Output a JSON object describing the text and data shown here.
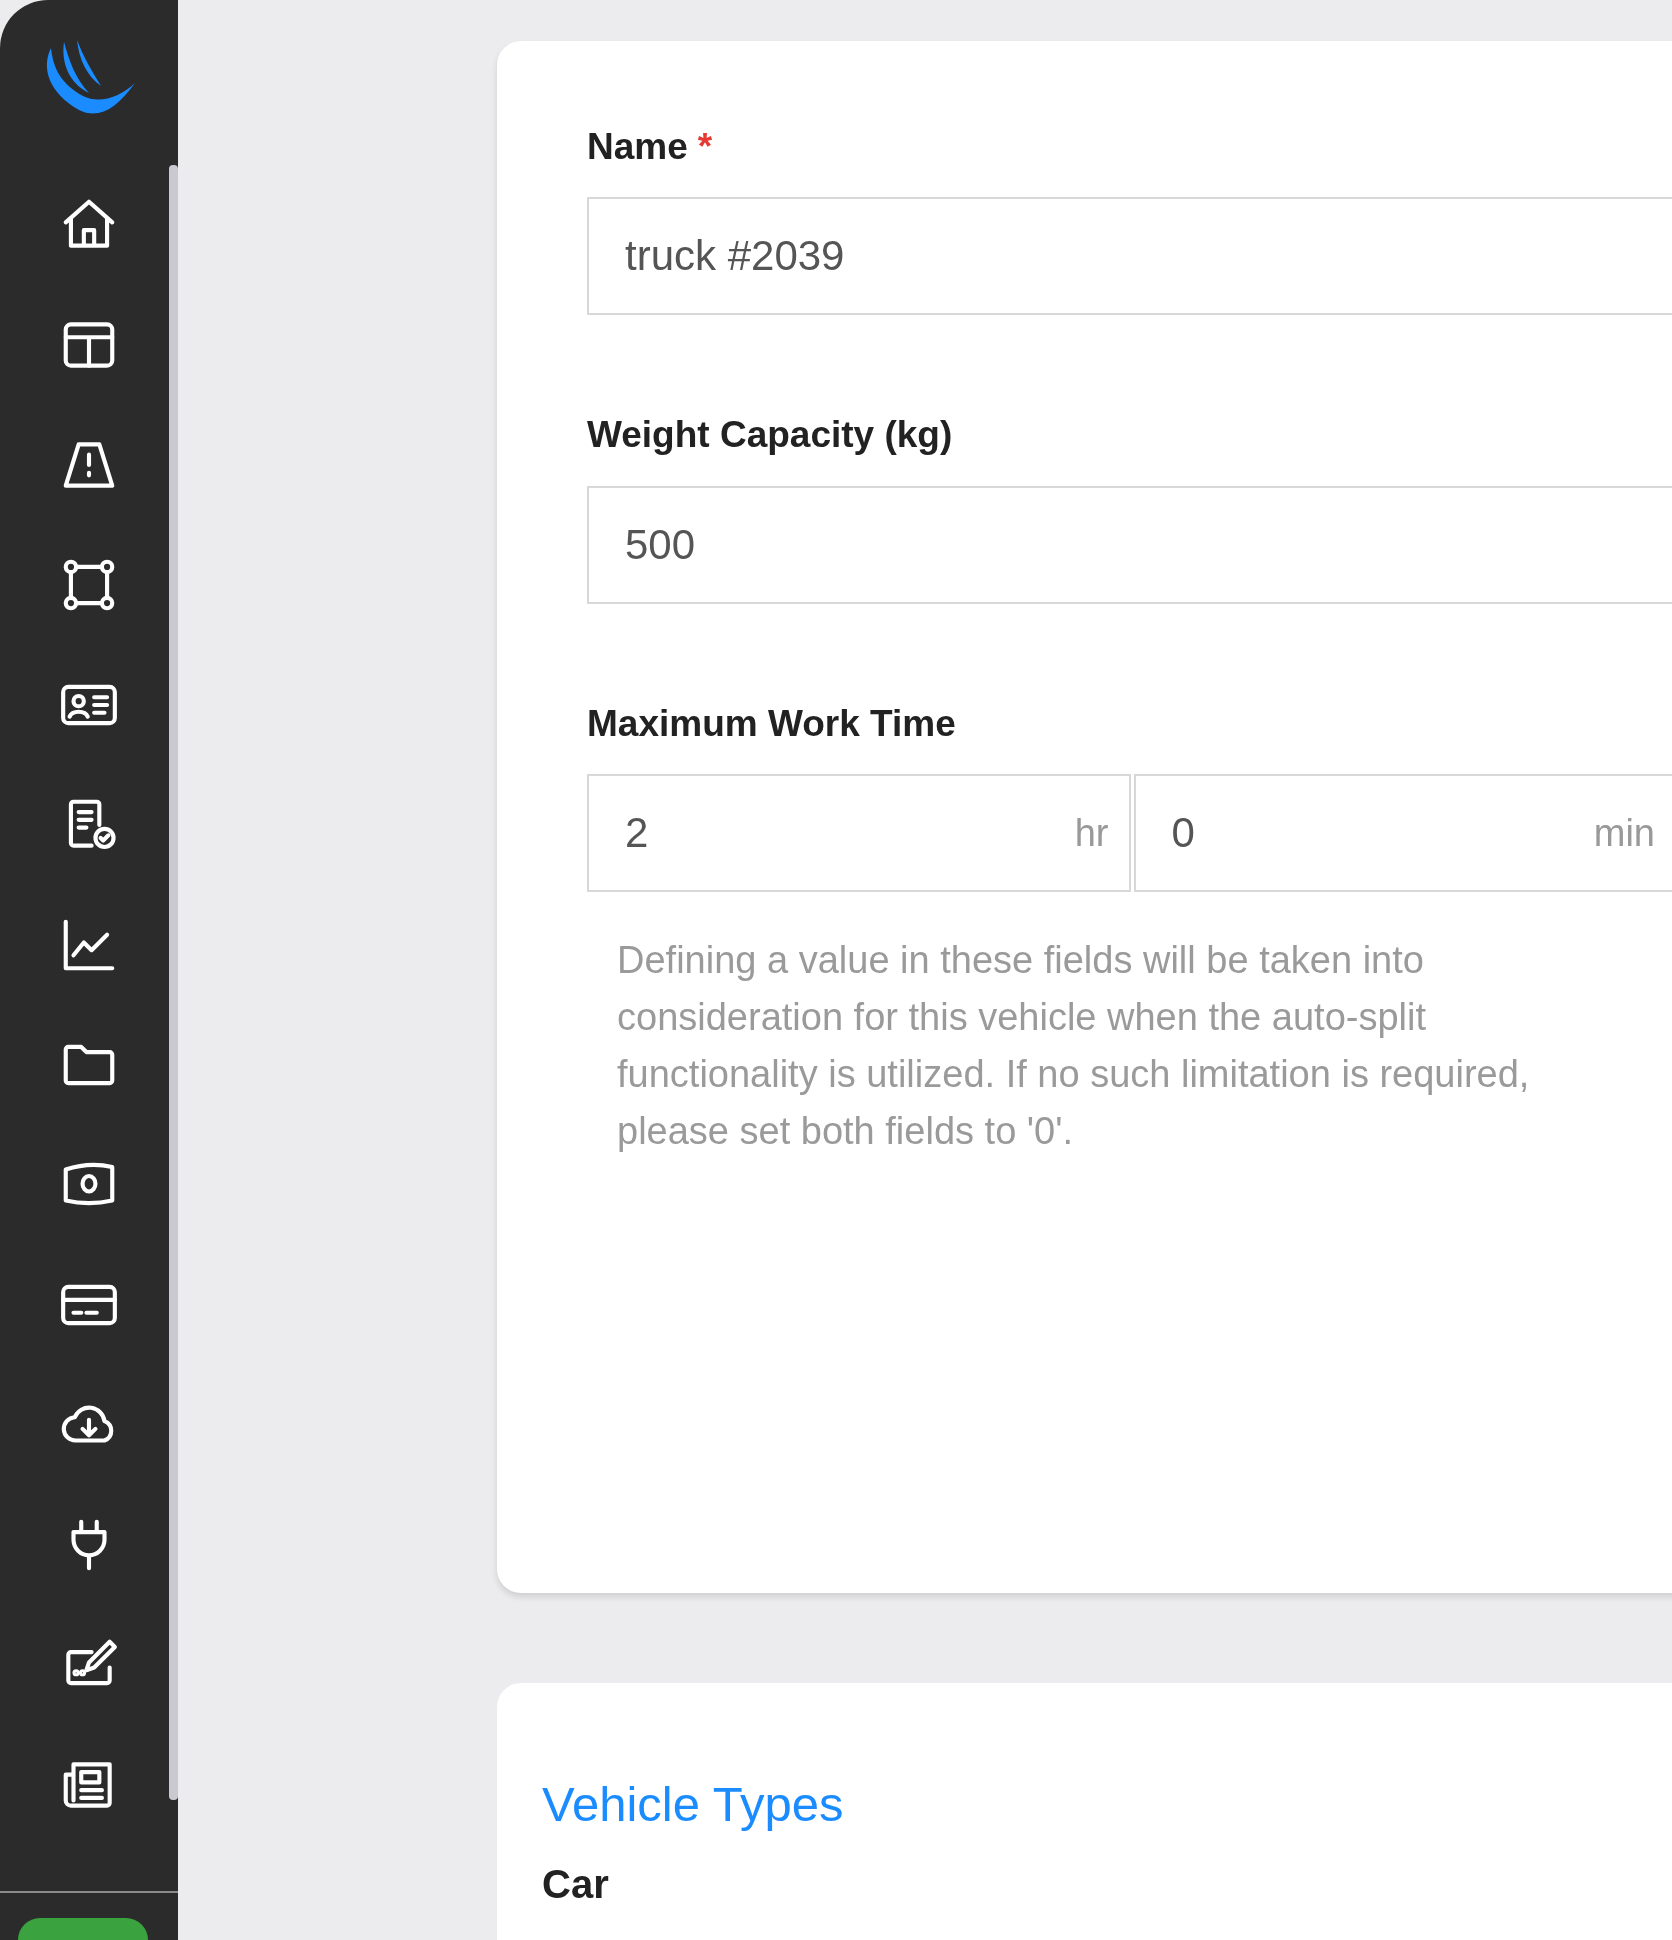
{
  "form": {
    "fields": [
      {
        "label": "Name",
        "required_mark": "*",
        "value": "truck #2039"
      },
      {
        "label": "Weight Capacity (kg)",
        "value": "500"
      }
    ],
    "work_time": {
      "label": "Maximum Work Time",
      "parts": [
        {
          "value": "2",
          "unit": "hr"
        },
        {
          "value": "0",
          "unit": "min"
        }
      ],
      "help": "Defining a value in these fields will be taken into consideration for this vehicle when the auto-split functionality is utilized. If no such limitation is required, please set both fields to '0'."
    }
  },
  "vehicle_types": {
    "title": "Vehicle Types",
    "items": [
      "Car"
    ]
  }
}
